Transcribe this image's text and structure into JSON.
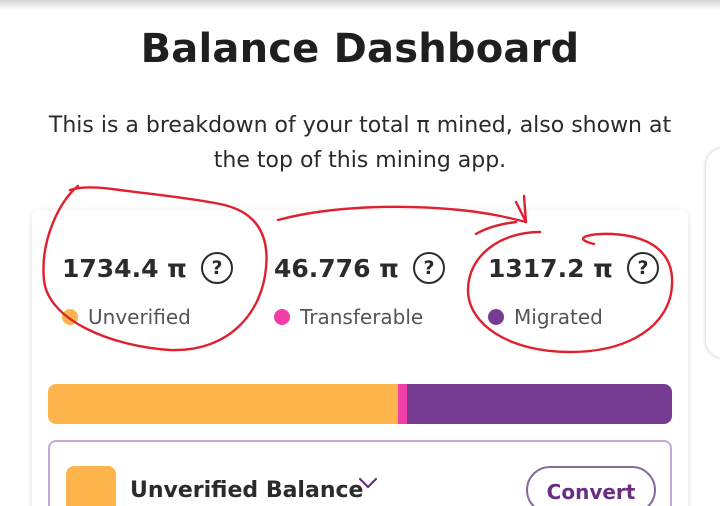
{
  "header": {
    "title": "Balance Dashboard",
    "description": "This is a breakdown of your total π mined, also shown at the top of this mining app."
  },
  "balances": [
    {
      "amount": "1734.4 π",
      "help": "?",
      "label": "Unverified",
      "color": "#fdb44b"
    },
    {
      "amount": "46.776 π",
      "help": "?",
      "label": "Transferable",
      "color": "#f23fa8"
    },
    {
      "amount": "1317.2 π",
      "help": "?",
      "label": "Migrated",
      "color": "#753c91"
    }
  ],
  "balance_bar": {
    "colors": [
      "#fdb44b",
      "#f23fa8",
      "#753c91"
    ]
  },
  "panel": {
    "title": "Unverified Balance",
    "swatch_color": "#fdb44b",
    "convert_label": "Convert"
  },
  "annotation_color": "#e0202f"
}
